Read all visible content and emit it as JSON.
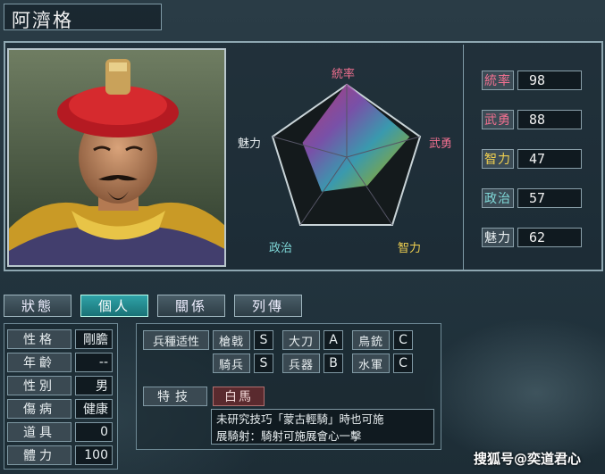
{
  "character": {
    "name": "阿濟格"
  },
  "radar": {
    "labels": [
      "統率",
      "武勇",
      "智力",
      "政治",
      "魅力"
    ],
    "label_colors": [
      "#f07090",
      "#f07090",
      "#f0d050",
      "#7fd8d8",
      "#e8eef0"
    ]
  },
  "stats": [
    {
      "label": "統率",
      "value": "98",
      "color": "#f07090"
    },
    {
      "label": "武勇",
      "value": "88",
      "color": "#f07090"
    },
    {
      "label": "智力",
      "value": "47",
      "color": "#f0d050"
    },
    {
      "label": "政治",
      "value": "57",
      "color": "#7fd8d8"
    },
    {
      "label": "魅力",
      "value": "62",
      "color": "#e8eef0"
    }
  ],
  "tabs": [
    {
      "label": "狀態",
      "active": false
    },
    {
      "label": "個人",
      "active": true
    },
    {
      "label": "關係",
      "active": false
    },
    {
      "label": "列傳",
      "active": false
    }
  ],
  "personal": [
    {
      "label": "性格",
      "value": "剛膽"
    },
    {
      "label": "年齡",
      "value": "--"
    },
    {
      "label": "性別",
      "value": "男"
    },
    {
      "label": "傷病",
      "value": "健康"
    },
    {
      "label": "道具",
      "value": "0"
    },
    {
      "label": "體力",
      "value": "100"
    }
  ],
  "aptitude": {
    "label": "兵種适性",
    "row1": [
      {
        "name": "槍戟",
        "grade": "S"
      },
      {
        "name": "大刀",
        "grade": "A"
      },
      {
        "name": "鳥銃",
        "grade": "C"
      }
    ],
    "row2": [
      {
        "name": "騎兵",
        "grade": "S"
      },
      {
        "name": "兵器",
        "grade": "B"
      },
      {
        "name": "水軍",
        "grade": "C"
      }
    ]
  },
  "skill": {
    "label": "特技",
    "name": "白馬",
    "desc_line1": "未研究技巧「蒙古輕騎」時也可施",
    "desc_line2": "展騎射：騎射可施展會心一擊"
  },
  "watermark": "搜狐号@奕道君心"
}
